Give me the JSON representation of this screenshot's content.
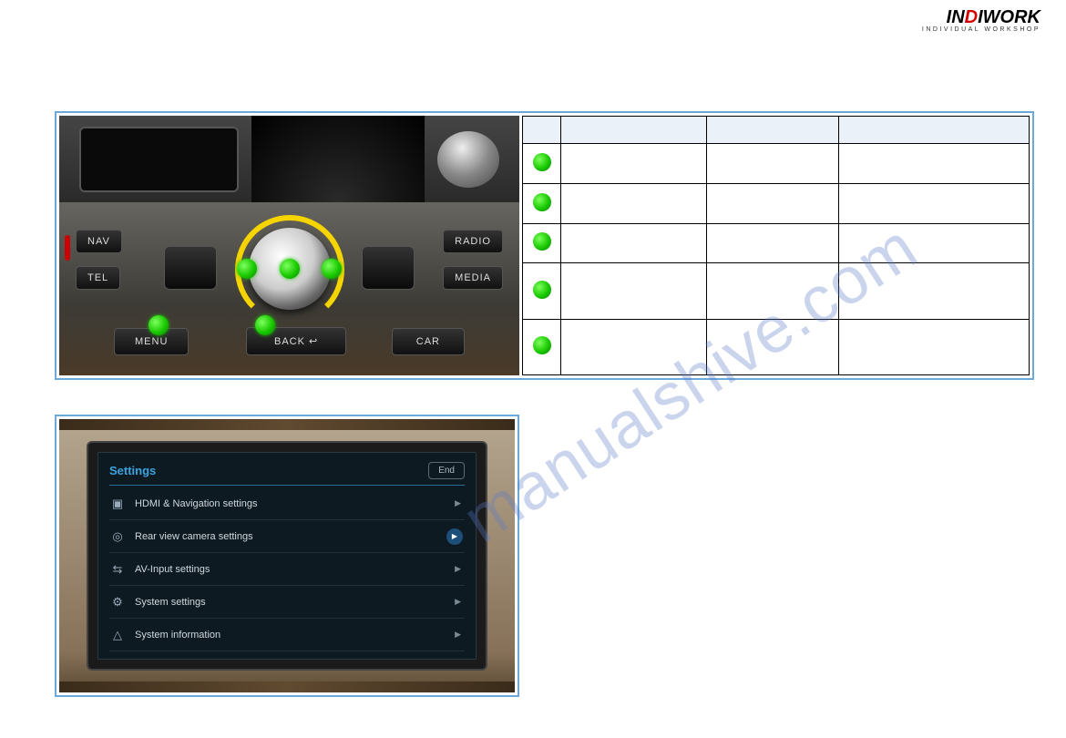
{
  "logo": {
    "main_a": "IN",
    "main_b": "D",
    "main_c": "IWORK",
    "sub": "INDIVIDUAL WORKSHOP"
  },
  "mmi": {
    "nav": "NAV",
    "tel": "TEL",
    "radio": "RADIO",
    "media": "MEDIA",
    "menu": "MENU",
    "back": "BACK ↩",
    "car": "CAR"
  },
  "table": {
    "head": {
      "a": "",
      "b": "",
      "c": ""
    },
    "rows": [
      {
        "b": "",
        "c": "",
        "d": ""
      },
      {
        "b": "",
        "c": "",
        "d": ""
      },
      {
        "b": "",
        "c": "",
        "d": ""
      },
      {
        "b": "",
        "c": "",
        "d": ""
      },
      {
        "b": "",
        "c": "",
        "d": ""
      }
    ]
  },
  "screen": {
    "title": "Settings",
    "end": "End",
    "items": [
      "HDMI & Navigation settings",
      "Rear view camera settings",
      "AV-Input settings",
      "System settings",
      "System information"
    ]
  },
  "watermark": "manualshive.com"
}
